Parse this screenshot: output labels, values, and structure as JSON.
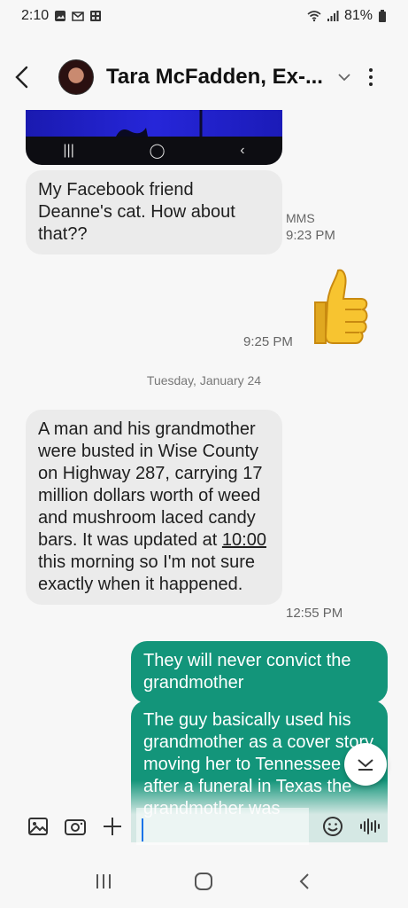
{
  "status_bar": {
    "time": "2:10",
    "battery": "81%",
    "icons_left": [
      "image-icon",
      "gmail-icon",
      "app-icon"
    ],
    "icons_right": [
      "wifi-icon",
      "signal-icon",
      "battery-icon"
    ]
  },
  "header": {
    "contact_name": "Tara McFadden, Ex-...",
    "icons": [
      "back-arrow-icon",
      "avatar",
      "chevron-down-icon",
      "more-vertical-icon"
    ]
  },
  "image_attachment": {
    "nav_icons": [
      "recents-icon",
      "home-icon",
      "back-icon"
    ]
  },
  "messages": [
    {
      "direction": "incoming",
      "text": "My Facebook friend Deanne's cat. How about that??",
      "meta_type": "MMS",
      "time": "9:23 PM"
    },
    {
      "direction": "outgoing",
      "emoji": "thumbs-up",
      "time": "9:25 PM"
    },
    {
      "direction": "incoming",
      "text_before_link": "A man and his grandmother were busted in Wise County on Highway 287, carrying 17 million dollars worth of weed and mushroom laced candy bars. It was updated at ",
      "link_text": "10:00",
      "text_after_link": " this morning so I'm not sure exactly when it happened.",
      "time": "12:55 PM"
    },
    {
      "direction": "outgoing",
      "text": "They will never convict the grandmother"
    },
    {
      "direction": "outgoing",
      "text": "The guy basically used his grandmother as a cover story moving her to Tennessee after a funeral in Texas the grandmother was"
    }
  ],
  "date_separator": "Tuesday, January 24",
  "composer": {
    "placeholder": "",
    "icons": [
      "gallery-icon",
      "camera-icon",
      "plus-icon",
      "emoji-icon",
      "voice-icon"
    ]
  },
  "nav_bar": {
    "icons": [
      "recents-icon",
      "home-icon",
      "back-icon"
    ]
  },
  "colors": {
    "outgoing_bubble": "#13957a",
    "incoming_bubble": "#ebebeb",
    "background": "#f7f7f7"
  }
}
